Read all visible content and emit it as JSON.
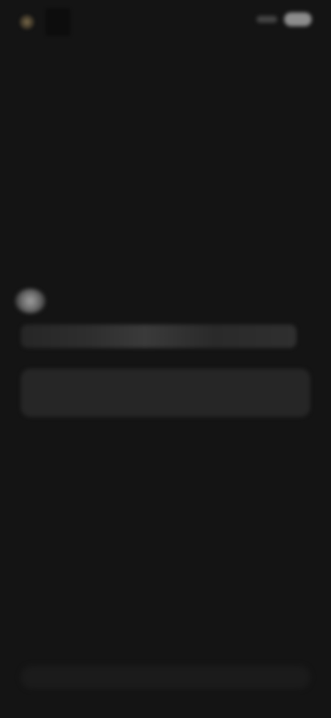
{
  "status_bar": {
    "left_text": "",
    "right_text": ""
  },
  "prompt": {
    "icon": "person-icon",
    "text": ""
  },
  "input": {
    "placeholder": "",
    "value": ""
  },
  "bottom_bar": {
    "label": ""
  },
  "colors": {
    "background": "#141414",
    "input_background": "#262626",
    "accent": "#7a6a4a"
  }
}
